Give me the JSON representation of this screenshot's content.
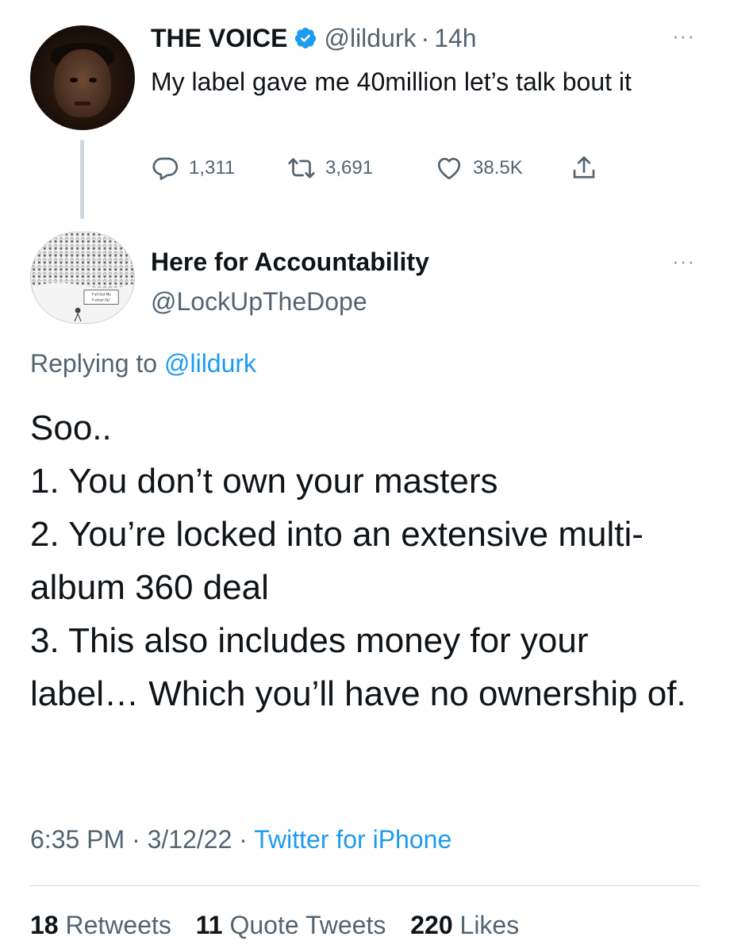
{
  "parent_tweet": {
    "display_name": "THE VOICE",
    "handle": "@lildurk",
    "separator": "·",
    "time": "14h",
    "text": "My label gave me 40million let’s talk bout it",
    "replies": "1,311",
    "retweets": "3,691",
    "likes": "38.5K",
    "more_glyph": "···"
  },
  "reply_tweet": {
    "display_name": "Here for Accountability",
    "handle": "@LockUpTheDope",
    "more_glyph": "···",
    "replying_prefix": "Replying to",
    "replying_to": "@lildurk",
    "text_lines": [
      "Soo..",
      "1. You don’t own your masters",
      "2. You’re locked into an extensive multi-album 360 deal",
      "3. This also includes money for your label… Which you’ll have no ownership of."
    ],
    "avatar_caption": "Y'all Got Me Fucked Up!",
    "meta": {
      "time": "6:35 PM",
      "sep1": "·",
      "date": "3/12/22",
      "sep2": "·",
      "source": "Twitter for iPhone"
    },
    "stats": {
      "retweets_count": "18",
      "retweets_label": "Retweets",
      "quotes_count": "11",
      "quotes_label": "Quote Tweets",
      "likes_count": "220",
      "likes_label": "Likes"
    }
  },
  "icons": {
    "verified": "verified-badge-icon",
    "reply": "reply-bubble-icon",
    "retweet": "retweet-icon",
    "like": "heart-icon",
    "share": "share-icon",
    "more": "more-dots-icon"
  },
  "colors": {
    "text": "#0f1419",
    "secondary": "#536471",
    "accent": "#1d9bf0",
    "divider": "#cfd9de"
  }
}
